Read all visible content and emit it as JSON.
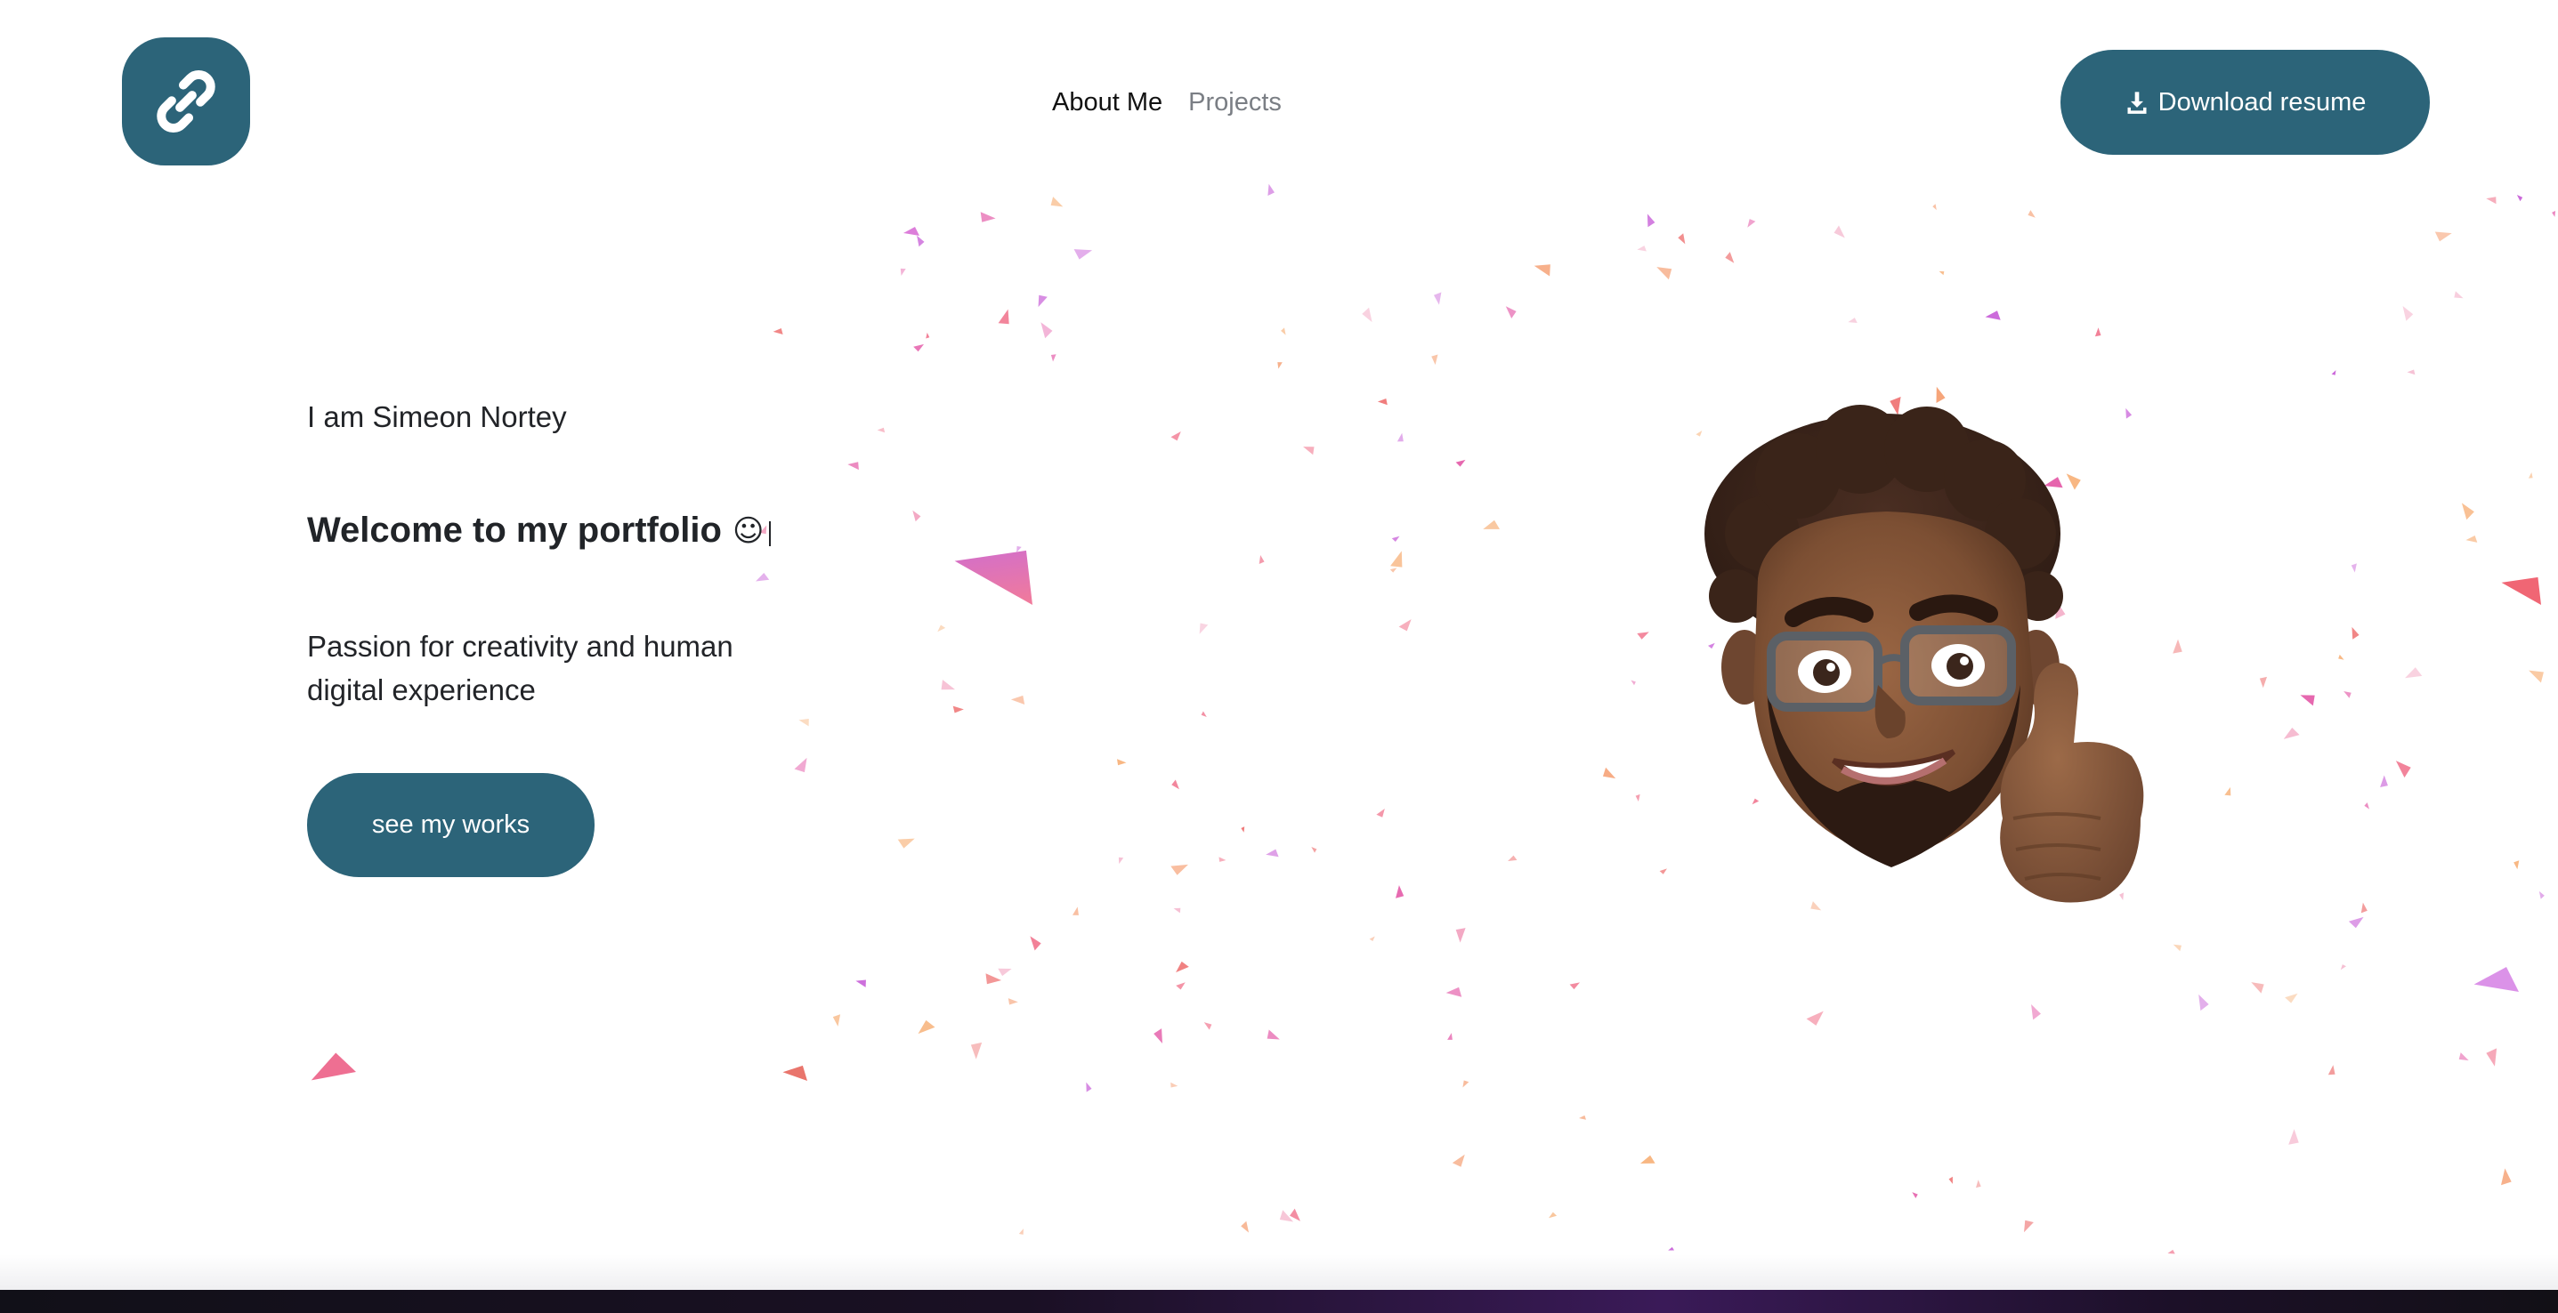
{
  "header": {
    "logo_icon": "link-icon",
    "nav": [
      {
        "label": "About Me",
        "active": true
      },
      {
        "label": "Projects",
        "active": false
      }
    ],
    "download_label": "Download resume",
    "download_icon": "download-icon"
  },
  "hero": {
    "intro": "I am Simeon Nortey",
    "headline": "Welcome to my portfolio",
    "headline_emoji": "☺",
    "tagline": "Passion for creativity and human digital experience",
    "cta_label": "see my works"
  },
  "colors": {
    "accent": "#2c6479",
    "background": "#ffffff",
    "text": "#222428",
    "nav_inactive": "#7a7e84"
  }
}
